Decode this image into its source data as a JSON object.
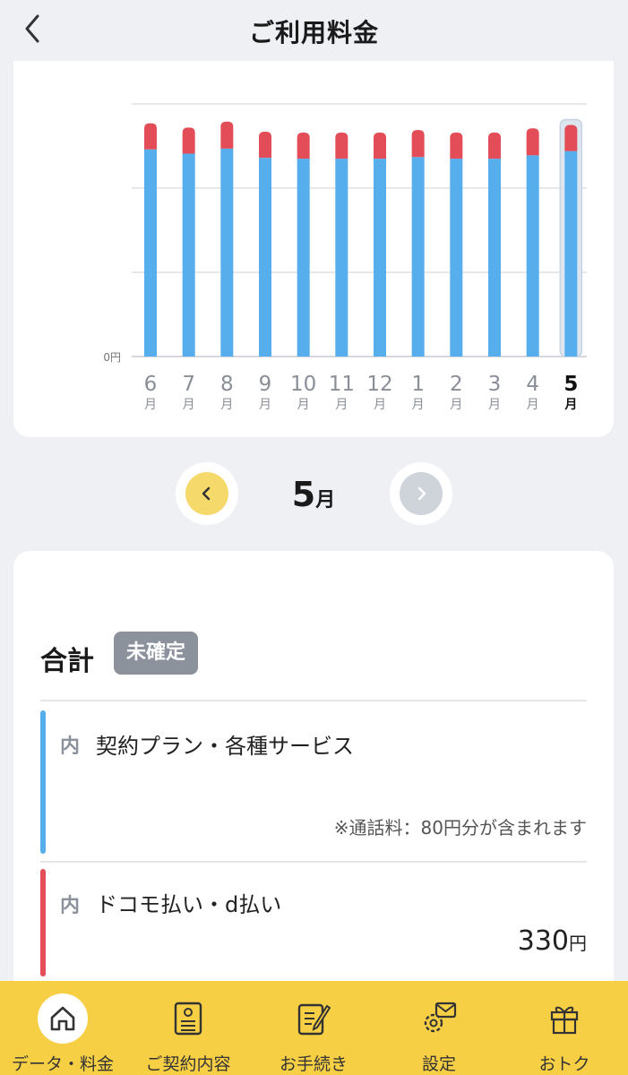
{
  "header": {
    "title": "ご利用料金"
  },
  "chart_data": {
    "type": "bar",
    "stacked": true,
    "categories": [
      "6",
      "7",
      "8",
      "9",
      "10",
      "11",
      "12",
      "1",
      "2",
      "3",
      "4",
      "5"
    ],
    "category_unit": "月",
    "selected_index": 11,
    "y_tick_label": "0円",
    "gridlines": 4,
    "series": [
      {
        "color": "#56aeed",
        "values": [
          2.46,
          2.41,
          2.47,
          2.36,
          2.35,
          2.35,
          2.35,
          2.37,
          2.35,
          2.35,
          2.39,
          2.44
        ]
      },
      {
        "color": "#e24d57",
        "values": [
          0.31,
          0.31,
          0.32,
          0.31,
          0.31,
          0.31,
          0.31,
          0.32,
          0.31,
          0.31,
          0.32,
          0.31
        ]
      }
    ],
    "ylim": [
      0,
      3
    ]
  },
  "month_nav": {
    "month_number": "5",
    "month_unit": "月"
  },
  "summary": {
    "total_label": "合計",
    "status_badge": "未確定",
    "items": [
      {
        "prefix": "内",
        "label": "契約プラン・各種サービス",
        "note": "※通話料：80円分が含まれます",
        "color": "#56aeed"
      },
      {
        "prefix": "内",
        "label": "ドコモ払い・d払い",
        "amount": "330",
        "amount_unit": "円",
        "color": "#e24d57"
      }
    ]
  },
  "tabbar": {
    "tabs": [
      {
        "label": "データ・料金",
        "icon": "home-icon",
        "active": true
      },
      {
        "label": "ご契約内容",
        "icon": "contract-icon",
        "active": false
      },
      {
        "label": "お手続き",
        "icon": "procedure-icon",
        "active": false
      },
      {
        "label": "設定",
        "icon": "settings-icon",
        "active": false
      },
      {
        "label": "おトク",
        "icon": "gift-icon",
        "active": false
      }
    ]
  }
}
